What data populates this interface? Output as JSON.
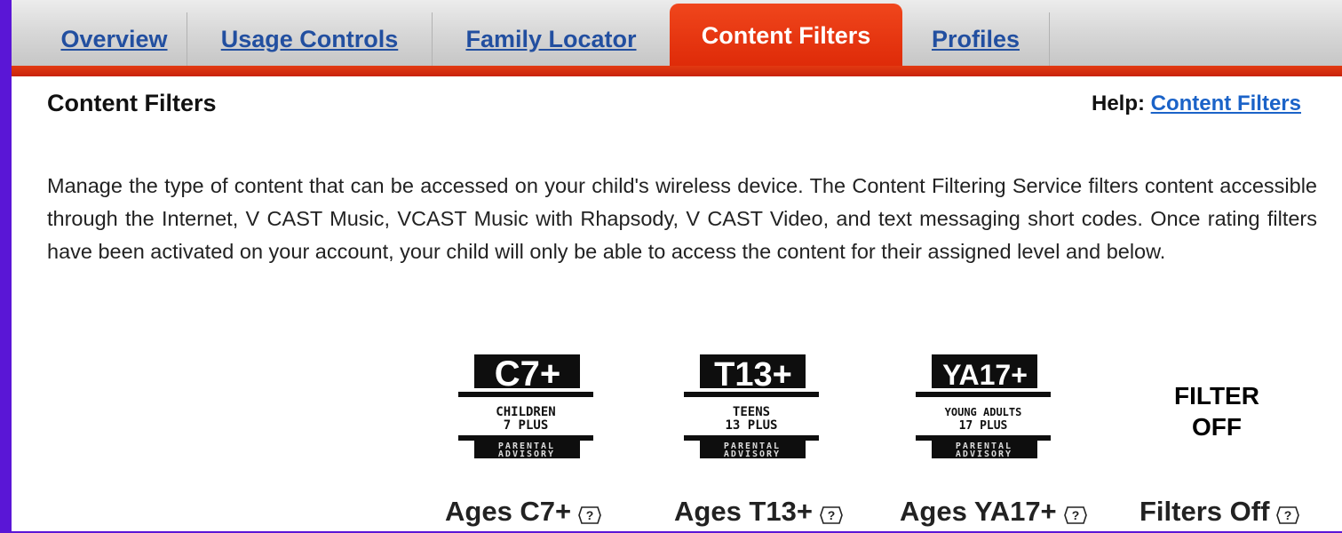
{
  "tabs": [
    {
      "label": "Overview",
      "active": false
    },
    {
      "label": "Usage Controls",
      "active": false
    },
    {
      "label": "Family Locator",
      "active": false
    },
    {
      "label": "Content Filters",
      "active": true
    },
    {
      "label": "Profiles",
      "active": false
    }
  ],
  "page_title": "Content Filters",
  "help": {
    "prefix": "Help:",
    "link": "Content Filters"
  },
  "description": "Manage the type of content that can be accessed on your child's wireless device. The Content Filtering Service filters content accessible through the Internet, V CAST Music, VCAST Music with Rhapsody, V CAST Video, and text messaging short codes. Once rating filters have been activated on your account, your child will only be able to access the content for their assigned level and below.",
  "ratings": [
    {
      "badge_code": "C7+",
      "badge_line1": "CHILDREN",
      "badge_line2": "7 PLUS",
      "advisory1": "PARENTAL",
      "advisory2": "ADVISORY",
      "label": "Ages C7+"
    },
    {
      "badge_code": "T13+",
      "badge_line1": "TEENS",
      "badge_line2": "13 PLUS",
      "advisory1": "PARENTAL",
      "advisory2": "ADVISORY",
      "label": "Ages T13+"
    },
    {
      "badge_code": "YA17+",
      "badge_line1": "YOUNG ADULTS",
      "badge_line2": "17 PLUS",
      "advisory1": "PARENTAL",
      "advisory2": "ADVISORY",
      "label": "Ages YA17+"
    },
    {
      "filter_off_line1": "FILTER",
      "filter_off_line2": "OFF",
      "label": "Filters Off"
    }
  ],
  "colors": {
    "accent_red": "#e0300c",
    "link_blue": "#1b63c8",
    "tab_link": "#224fa0",
    "outer_bg": "#5a16d6"
  },
  "icons": {
    "help_icon": "question-mark-icon"
  }
}
